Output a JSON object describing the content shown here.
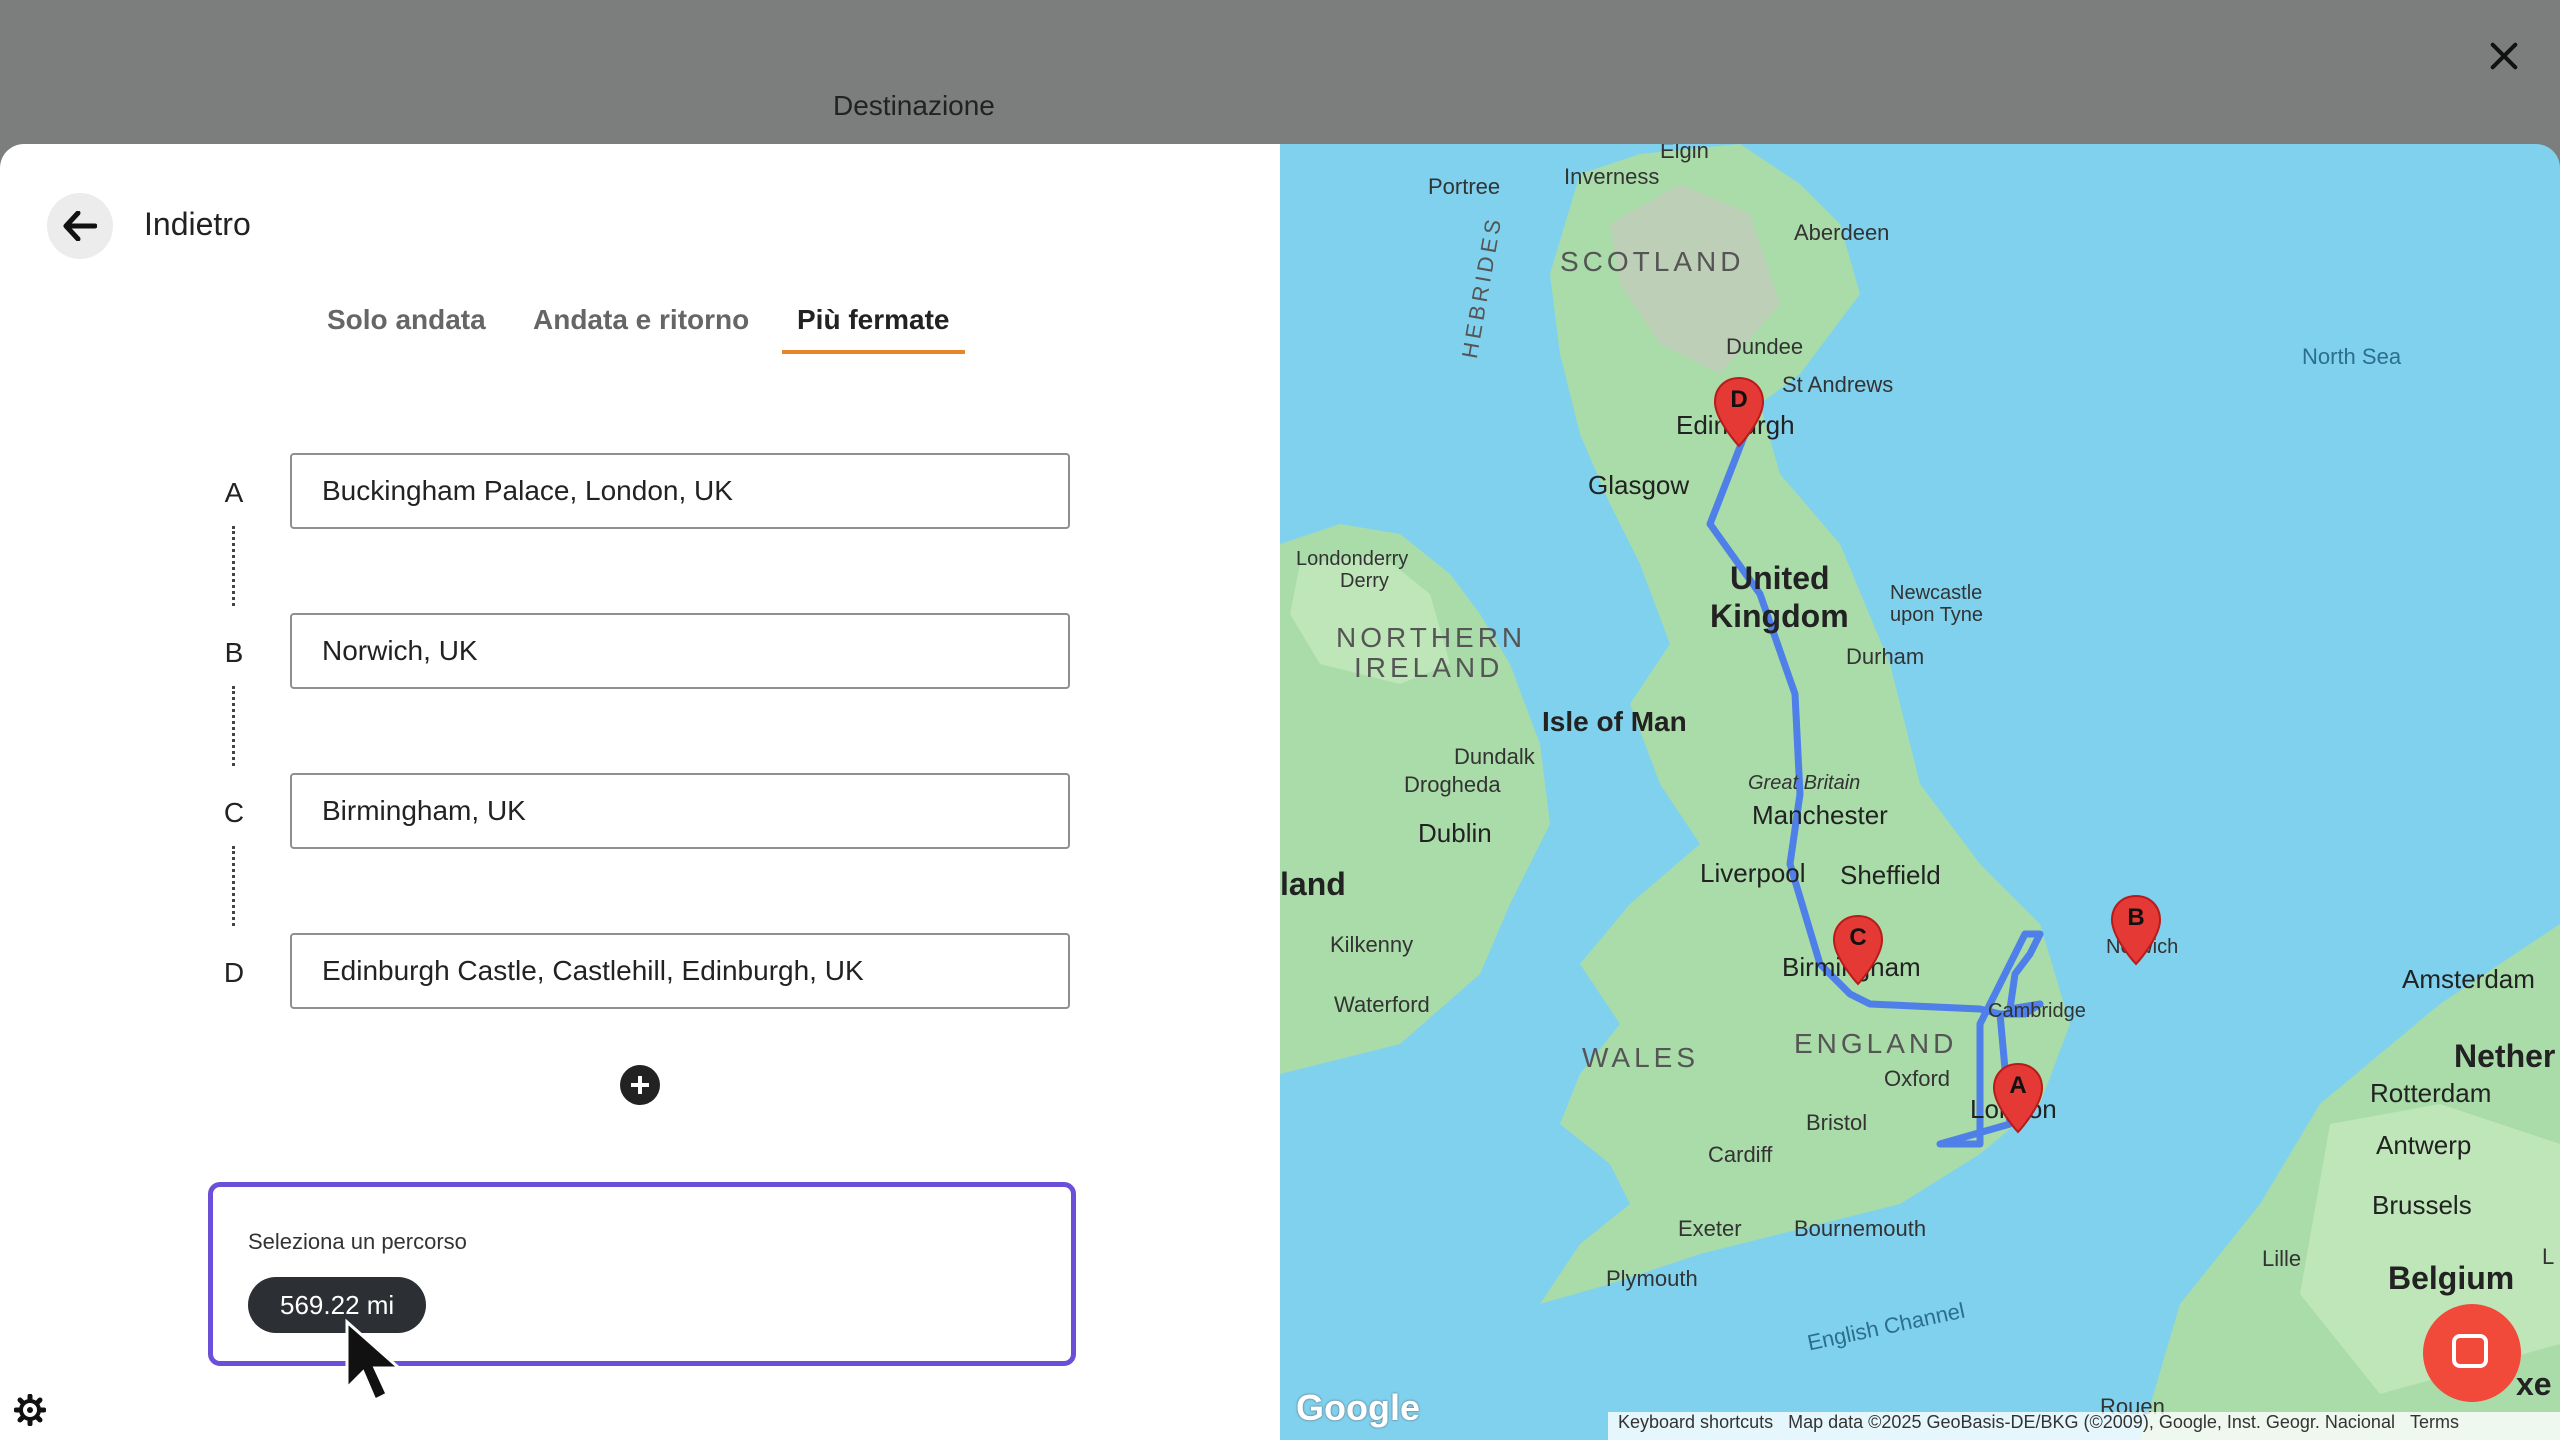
{
  "header": {
    "title": "Destinazione"
  },
  "back": {
    "label": "Indietro"
  },
  "tabs": [
    {
      "label": "Solo andata",
      "active": false
    },
    {
      "label": "Andata e ritorno",
      "active": false
    },
    {
      "label": "Più fermate",
      "active": true
    }
  ],
  "stops": [
    {
      "letter": "A",
      "value": "Buckingham Palace, London, UK"
    },
    {
      "letter": "B",
      "value": "Norwich, UK"
    },
    {
      "letter": "C",
      "value": "Birmingham, UK"
    },
    {
      "letter": "D",
      "value": "Edinburgh Castle, Castlehill, Edinburgh, UK"
    }
  ],
  "route": {
    "label": "Seleziona un percorso",
    "distance": "569.22 mi"
  },
  "colors": {
    "accent_tab": "#e8852b",
    "route_box": "#6b4fd8",
    "route_line": "#4f7fe8",
    "marker": "#e53935",
    "chat": "#f14a3a"
  },
  "map": {
    "labels": {
      "elgin": "Elgin",
      "portree": "Portree",
      "inverness": "Inverness",
      "aberdeen": "Aberdeen",
      "scotland": "SCOTLAND",
      "hebrides": "HEBRIDES",
      "dundee": "Dundee",
      "st_andrews": "St Andrews",
      "north_sea": "North Sea",
      "edinburgh": "Edinburgh",
      "glasgow": "Glasgow",
      "londonderry": "Londonderry",
      "derry": "Derry",
      "northern": "NORTHERN",
      "ireland_region": "IRELAND",
      "united": "United",
      "kingdom": "Kingdom",
      "newcastle": "Newcastle",
      "upon_tyne": "upon Tyne",
      "durham": "Durham",
      "isle_of_man": "Isle of Man",
      "dundalk": "Dundalk",
      "drogheda": "Drogheda",
      "great_britain": "Great Britain",
      "manchester": "Manchester",
      "dublin": "Dublin",
      "liverpool": "Liverpool",
      "sheffield": "Sheffield",
      "ireland_cut": "land",
      "kilkenny": "Kilkenny",
      "norwich": "Norwich",
      "birmingham": "Birmingham",
      "amsterdam": "Amsterdam",
      "cambridge": "Cambridge",
      "waterford": "Waterford",
      "england": "ENGLAND",
      "wales": "WALES",
      "oxford": "Oxford",
      "netherlands_cut": "Nether",
      "rotterdam": "Rotterdam",
      "london": "London",
      "bristol": "Bristol",
      "cardiff": "Cardiff",
      "antwerp": "Antwerp",
      "brussels": "Brussels",
      "exeter": "Exeter",
      "bournemouth": "Bournemouth",
      "lille": "Lille",
      "belgium": "Belgium",
      "plymouth": "Plymouth",
      "english_channel": "English Channel",
      "rouen": "Rouen",
      "lux_cut": "xe",
      "lux_cut2": "L"
    },
    "markers": [
      "A",
      "B",
      "C",
      "D"
    ],
    "google": "Google",
    "keyboard_shortcuts": "Keyboard shortcuts",
    "map_data": "Map data ©2025 GeoBasis-DE/BKG (©2009), Google, Inst. Geogr. Nacional",
    "terms": "Terms"
  }
}
